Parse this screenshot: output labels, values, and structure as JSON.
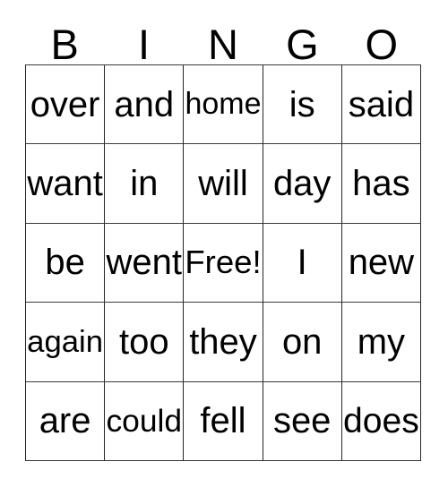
{
  "card": {
    "title": "BINGO",
    "header_letters": [
      "B",
      "I",
      "N",
      "G",
      "O"
    ],
    "free_space_label": "Free!",
    "free_space_position": {
      "row": 3,
      "column": 3
    },
    "grid_size": "5x5",
    "text_color": "#000000",
    "background_color": "#ffffff",
    "border_color": "#262626",
    "rows": [
      {
        "cells": [
          "over",
          "and",
          "home",
          "is",
          "said"
        ]
      },
      {
        "cells": [
          "want",
          "in",
          "will",
          "day",
          "has"
        ]
      },
      {
        "cells": [
          "be",
          "went",
          "Free!",
          "I",
          "new"
        ]
      },
      {
        "cells": [
          "again",
          "too",
          "they",
          "on",
          "my"
        ]
      },
      {
        "cells": [
          "are",
          "could",
          "fell",
          "see",
          "does"
        ]
      }
    ],
    "columns": {
      "B": [
        "over",
        "want",
        "be",
        "again",
        "are"
      ],
      "I": [
        "and",
        "in",
        "went",
        "too",
        "could"
      ],
      "N": [
        "home",
        "will",
        "Free!",
        "they",
        "fell"
      ],
      "G": [
        "is",
        "day",
        "I",
        "on",
        "see"
      ],
      "O": [
        "said",
        "has",
        "new",
        "my",
        "does"
      ]
    }
  }
}
